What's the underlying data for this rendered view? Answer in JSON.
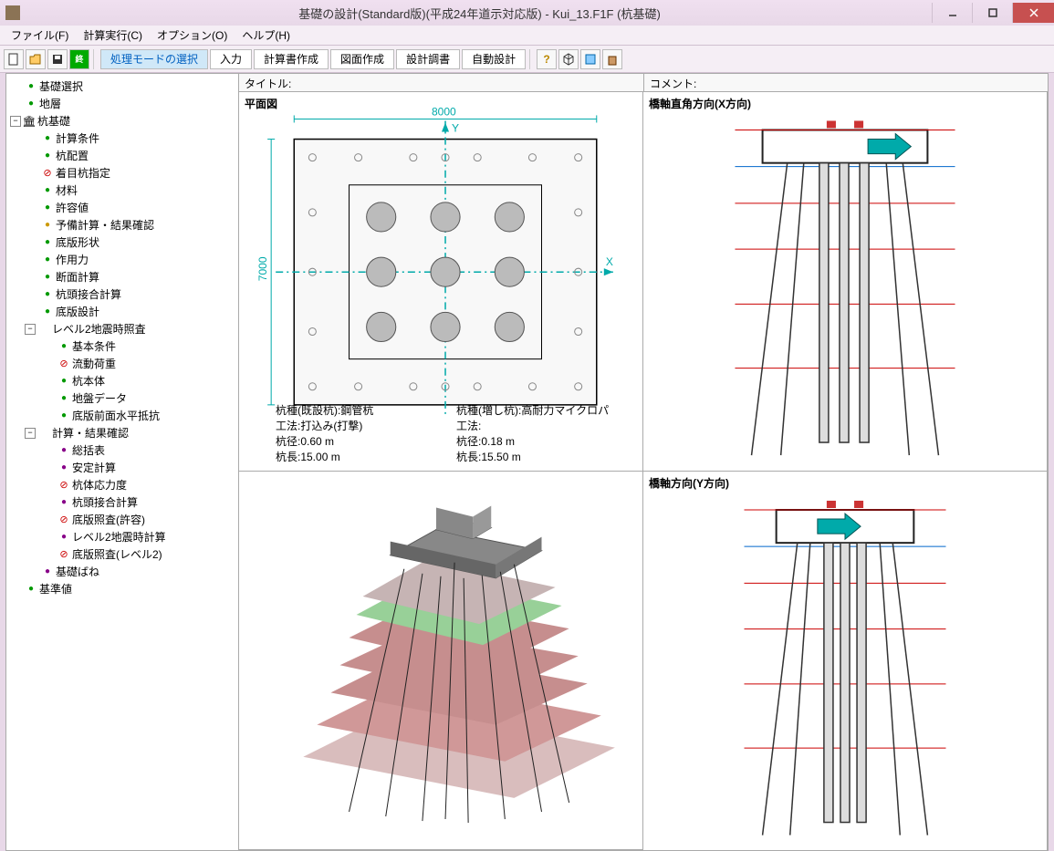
{
  "window": {
    "title": "基礎の設計(Standard版)(平成24年道示対応版) - Kui_13.F1F (杭基礎)"
  },
  "menu": {
    "file": "ファイル(F)",
    "calc": "計算実行(C)",
    "option": "オプション(O)",
    "help": "ヘルプ(H)"
  },
  "toolbar": {
    "mode": "処理モードの選択",
    "input": "入力",
    "report": "計算書作成",
    "drawing": "図面作成",
    "design_check": "設計調書",
    "auto": "自動設計"
  },
  "tree": {
    "n0": "基礎選択",
    "n1": "地層",
    "n2": "杭基礎",
    "n3": "計算条件",
    "n4": "杭配置",
    "n5": "着目杭指定",
    "n6": "材料",
    "n7": "許容値",
    "n8": "予備計算・結果確認",
    "n9": "底版形状",
    "n10": "作用力",
    "n11": "断面計算",
    "n12": "杭頭接合計算",
    "n13": "底版設計",
    "n14": "レベル2地震時照査",
    "n15": "基本条件",
    "n16": "流動荷重",
    "n17": "杭本体",
    "n18": "地盤データ",
    "n19": "底版前面水平抵抗",
    "n20": "計算・結果確認",
    "n21": "総括表",
    "n22": "安定計算",
    "n23": "杭体応力度",
    "n24": "杭頭接合計算",
    "n25": "底版照査(許容)",
    "n26": "レベル2地震時計算",
    "n27": "底版照査(レベル2)",
    "n28": "基礎ばね",
    "n29": "基準値"
  },
  "panels": {
    "title_label": "タイトル:",
    "comment_label": "コメント:",
    "plan_title": "平面図",
    "side_x_title": "橋軸直角方向(X方向)",
    "side_y_title": "橋軸方向(Y方向)",
    "dim_w": "8000",
    "dim_h": "7000",
    "axis_x": "X",
    "axis_y": "Y"
  },
  "info": {
    "left": {
      "l1": "杭種(既設杭):鋼管杭",
      "l2": "工法:打込み(打撃)",
      "l3": "杭径:0.60 m",
      "l4": "杭長:15.00 m"
    },
    "right": {
      "l1": "杭種(増し杭):高耐力マイクロパ",
      "l2": "工法:",
      "l3": "杭径:0.18 m",
      "l4": "杭長:15.50 m"
    }
  }
}
